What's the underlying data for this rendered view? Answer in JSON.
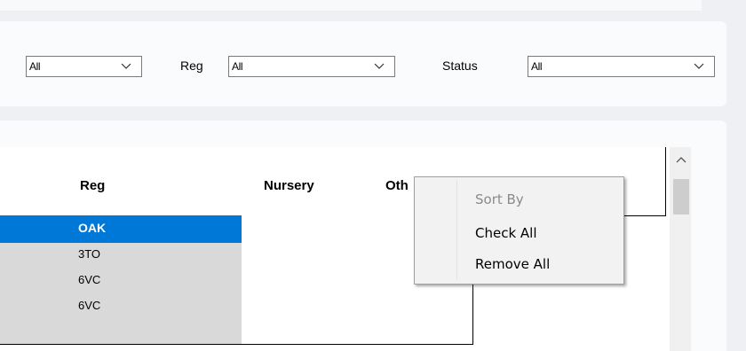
{
  "filters": {
    "first": {
      "value": "All"
    },
    "reg": {
      "label": "Reg",
      "value": "All"
    },
    "status": {
      "label": "Status",
      "value": "All"
    }
  },
  "grid": {
    "columns": {
      "reg": "Reg",
      "nursery": "Nursery",
      "other": "Oth"
    },
    "rows": [
      {
        "reg": "OAK",
        "selected": true
      },
      {
        "reg": "3TO",
        "selected": false
      },
      {
        "reg": "6VC",
        "selected": false
      },
      {
        "reg": "6VC",
        "selected": false
      }
    ]
  },
  "context_menu": {
    "items": [
      {
        "label": "Sort By",
        "enabled": false
      },
      {
        "label": "Check All",
        "enabled": true
      },
      {
        "label": "Remove All",
        "enabled": true
      }
    ]
  },
  "colors": {
    "selection": "#0078d7",
    "row_header": "#d9d9d9",
    "grid_line": "#000000"
  }
}
